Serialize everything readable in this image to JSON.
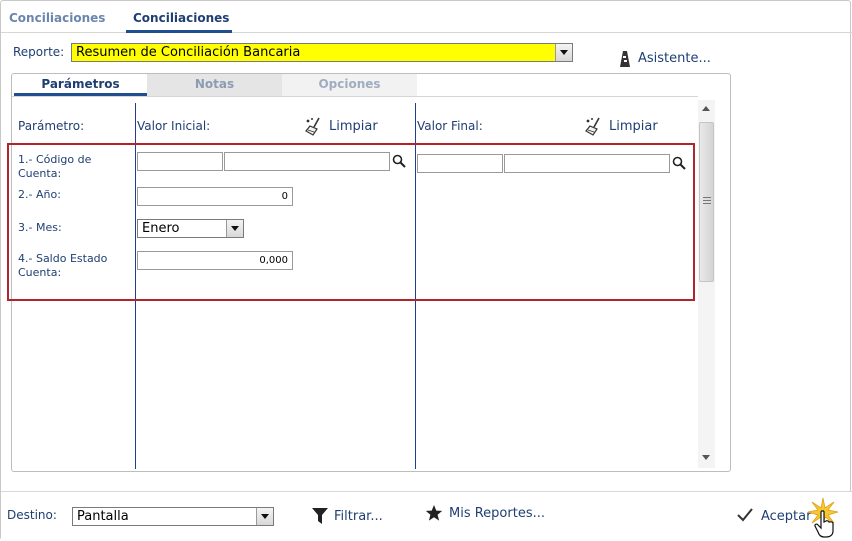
{
  "tabs": {
    "first": "Conciliaciones",
    "second": "Conciliaciones"
  },
  "reporte": {
    "label": "Reporte:",
    "value": "Resumen de Conciliación Bancaria",
    "highlight_color": "#ffff00"
  },
  "asistente": {
    "label": "Asistente..."
  },
  "panel_tabs": {
    "parametros": "Parámetros",
    "notas": "Notas",
    "opciones": "Opciones"
  },
  "columns": {
    "parametro": "Parámetro:",
    "valor_inicial": "Valor Inicial:",
    "valor_final": "Valor Final:",
    "limpiar": "Limpiar"
  },
  "params": {
    "p1": {
      "label_line1": "1.- Código de",
      "label_line2": "Cuenta:"
    },
    "p2": {
      "label": "2.- Año:",
      "value": "0"
    },
    "p3": {
      "label": "3.- Mes:",
      "value": "Enero"
    },
    "p4": {
      "label_line1": "4.- Saldo Estado",
      "label_line2": "Cuenta:",
      "value": "0,000"
    }
  },
  "bottom": {
    "destino_label": "Destino:",
    "destino_value": "Pantalla",
    "filtrar": "Filtrar...",
    "mis_reportes": "Mis Reportes...",
    "aceptar": "Aceptar"
  },
  "colors": {
    "accent": "#1f4f8f",
    "text": "#1f3f73",
    "highlight_border": "#b0242b"
  }
}
